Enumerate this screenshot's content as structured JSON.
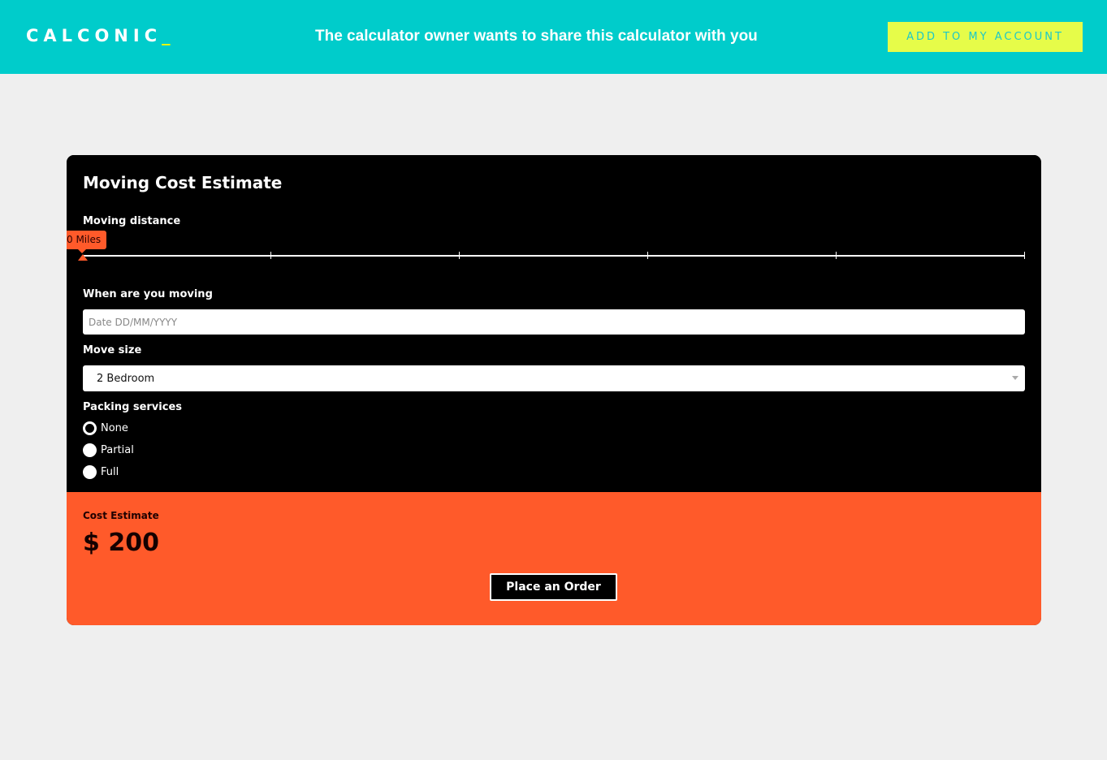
{
  "header": {
    "logo_text": "CALCONIC",
    "logo_cursor": "_",
    "message": "The calculator owner wants to share this calculator with you",
    "add_button_label": "ADD TO MY ACCOUNT",
    "colors": {
      "banner": "#00cccb",
      "button": "#e6fc49",
      "button_text": "#1cc8c9",
      "logo_cursor": "#e6f700"
    }
  },
  "calculator": {
    "title": "Moving Cost Estimate",
    "distance": {
      "label": "Moving distance",
      "value_display": "0 Miles",
      "value": 0,
      "tick_count": 6
    },
    "date": {
      "label": "When are you moving",
      "placeholder": "Date DD/MM/YYYY",
      "value": ""
    },
    "move_size": {
      "label": "Move size",
      "selected": "2 Bedroom"
    },
    "packing": {
      "label": "Packing services",
      "options": [
        {
          "label": "None",
          "selected": true
        },
        {
          "label": "Partial",
          "selected": false
        },
        {
          "label": "Full",
          "selected": false
        }
      ]
    },
    "result": {
      "label": "Cost Estimate",
      "value": "$ 200",
      "order_button_label": "Place an Order"
    },
    "colors": {
      "panel": "#000000",
      "accent": "#ff5a2a"
    }
  }
}
